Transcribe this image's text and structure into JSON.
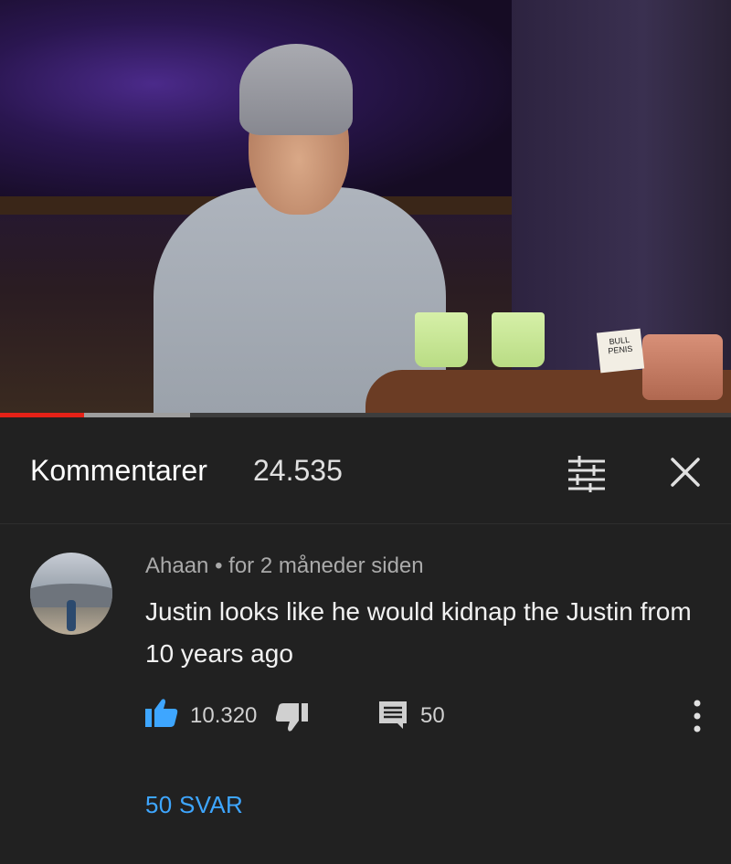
{
  "video": {
    "progress_played": 0.115,
    "progress_buffered": 0.26,
    "sign_text": "BULL PENIS"
  },
  "header": {
    "title": "Kommentarer",
    "count": "24.535",
    "sort_icon": "sort-icon",
    "close_icon": "close-icon"
  },
  "comment": {
    "author": "Ahaan",
    "separator": "•",
    "time": "for 2 måneder siden",
    "text": "Justin looks like he would kidnap the Justin from 10 years ago",
    "likes": "10.320",
    "replies": "50",
    "replies_link": "50 SVAR"
  },
  "colors": {
    "background": "#212121",
    "link": "#3ea6ff",
    "progress": "#e62117"
  }
}
